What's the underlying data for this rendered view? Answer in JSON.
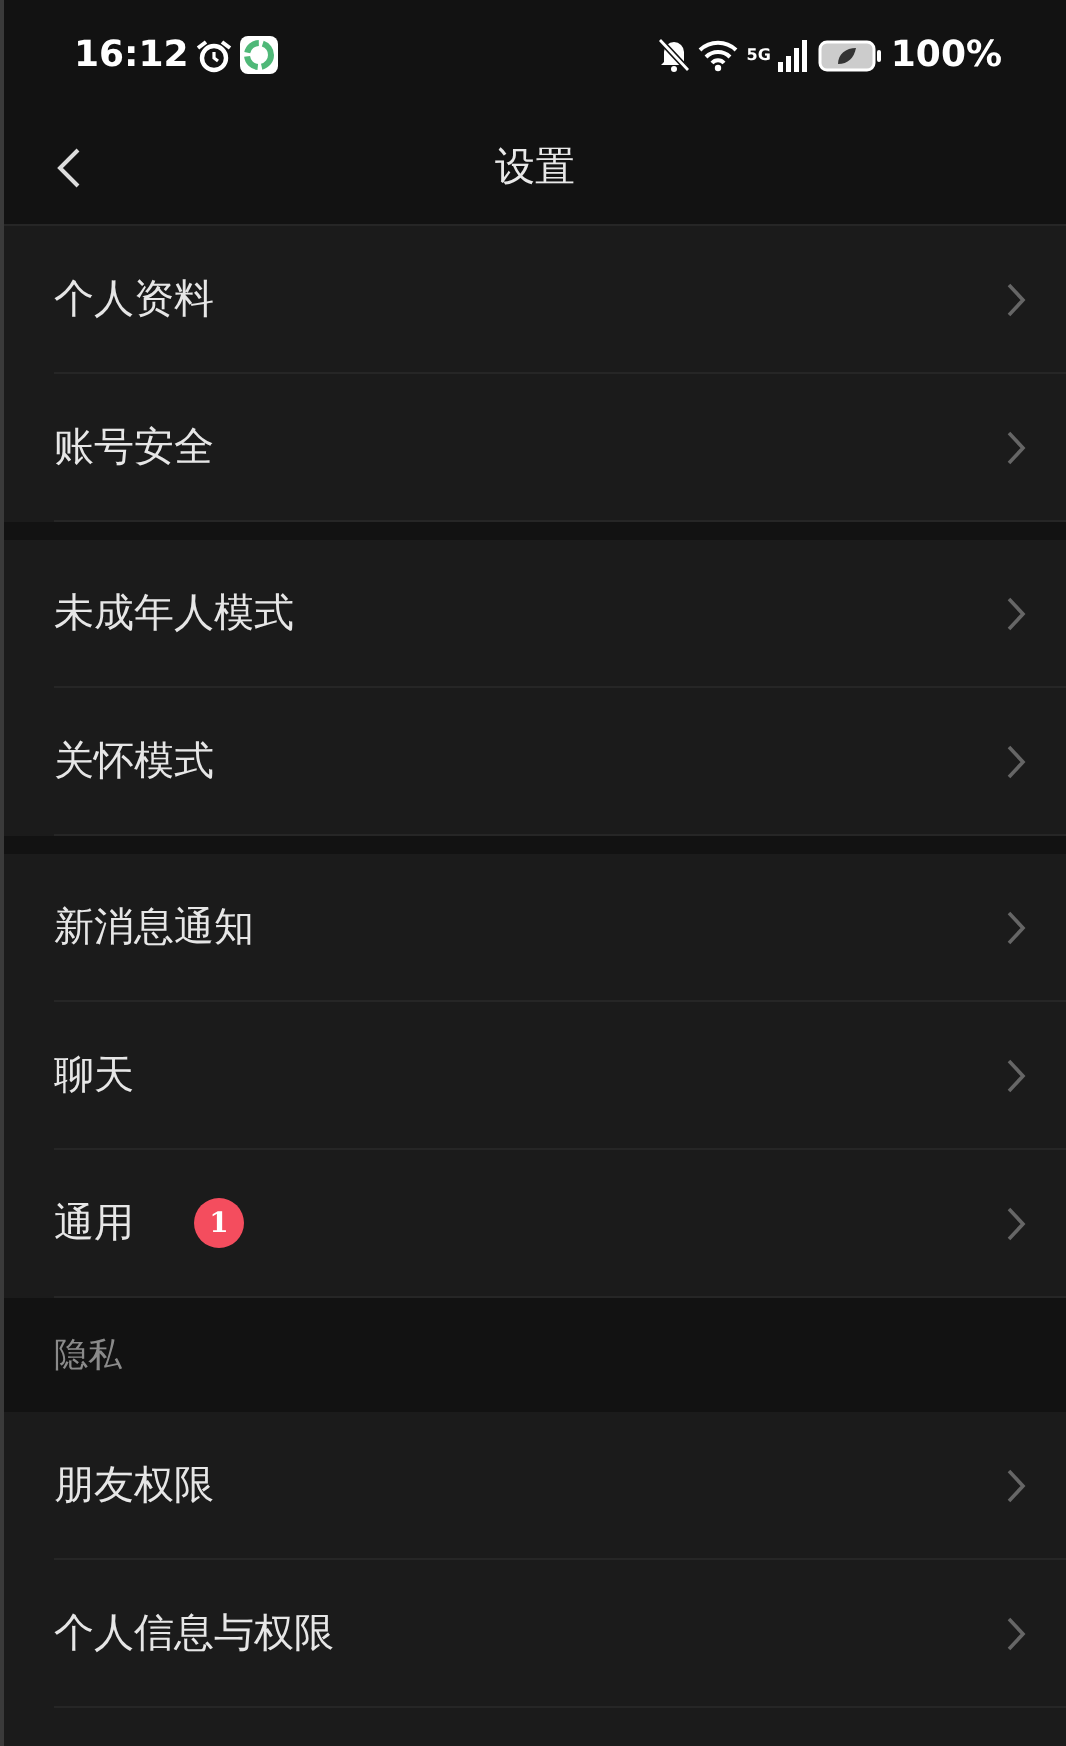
{
  "status_bar": {
    "time": "16:12",
    "network": "5G",
    "battery": "100%"
  },
  "header": {
    "title": "设置"
  },
  "groups": [
    {
      "items": [
        {
          "label": "个人资料"
        },
        {
          "label": "账号安全"
        }
      ]
    },
    {
      "items": [
        {
          "label": "未成年人模式"
        },
        {
          "label": "关怀模式"
        }
      ]
    },
    {
      "items": [
        {
          "label": "新消息通知"
        },
        {
          "label": "聊天"
        },
        {
          "label": "通用",
          "badge": "1"
        }
      ]
    },
    {
      "title": "隐私",
      "items": [
        {
          "label": "朋友权限"
        },
        {
          "label": "个人信息与权限"
        }
      ]
    }
  ]
}
